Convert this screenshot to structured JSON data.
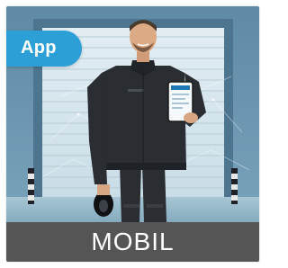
{
  "badge": {
    "label": "App",
    "color": "#2d9fd7"
  },
  "caption": {
    "label": "MOBIL",
    "background": "#555555"
  },
  "scene": {
    "phone_screen_color": "#eef4f8",
    "phone_header_color": "#1f78b4",
    "uniform_color": "#2a2d31"
  }
}
